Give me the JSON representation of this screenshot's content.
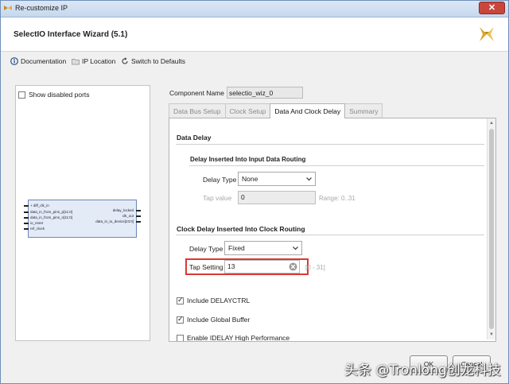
{
  "window": {
    "title": "Re-customize IP",
    "close_glyph": "✕"
  },
  "header": {
    "wizard_title": "SelectIO Interface Wizard (5.1)"
  },
  "toolbar": {
    "documentation": "Documentation",
    "ip_location": "IP Location",
    "switch_defaults": "Switch to Defaults"
  },
  "left_panel": {
    "show_disabled_ports": "Show disabled ports",
    "ports_left": [
      "+ diff_clk_in",
      "data_in_from_pins_p[11:0]",
      "data_in_from_pins_n[11:0]",
      "io_reset",
      "ref_clock"
    ],
    "ports_right": [
      "delay_locked",
      "clk_out",
      "data_in_to_device[23:0]"
    ]
  },
  "component": {
    "label": "Component Name",
    "value": "selectio_wiz_0"
  },
  "tabs": [
    {
      "label": "Data Bus Setup"
    },
    {
      "label": "Clock Setup"
    },
    {
      "label": "Data And Clock Delay"
    },
    {
      "label": "Summary"
    }
  ],
  "data_delay": {
    "title": "Data Delay",
    "subtitle": "Delay Inserted Into Input Data Routing",
    "delay_type_label": "Delay Type",
    "delay_type_value": "None",
    "tap_value_label": "Tap value",
    "tap_value": "0",
    "range": "Range: 0..31"
  },
  "clock_delay": {
    "title": "Clock Delay Inserted Into Clock Routing",
    "delay_type_label": "Delay Type",
    "delay_type_value": "Fixed",
    "tap_setting_label": "Tap Setting",
    "tap_setting_value": "13",
    "range": "[0 - 31]"
  },
  "options": {
    "include_delayctrl": "Include DELAYCTRL",
    "include_global_buffer": "Include Global Buffer",
    "enable_high_perf": "Enable IDELAY High Performance"
  },
  "buttons": {
    "ok": "OK",
    "cancel": "Cancel"
  },
  "watermark": "头条 @Tronlong创龙科技",
  "colors": {
    "highlight": "#d93a32",
    "active_tab": "#ffffff",
    "logo": "#d8a530"
  }
}
